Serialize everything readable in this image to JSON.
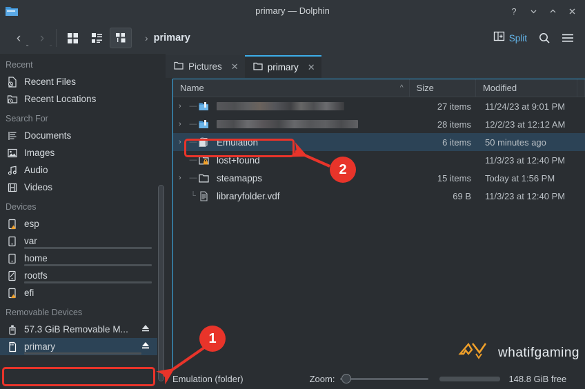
{
  "window": {
    "title": "primary — Dolphin",
    "icon": "folder-icon",
    "buttons": [
      {
        "name": "help-button",
        "glyph": "?"
      },
      {
        "name": "minimize-button",
        "glyph": "chevron-down-icon"
      },
      {
        "name": "maximize-button",
        "glyph": "chevron-up-icon"
      },
      {
        "name": "close-button",
        "glyph": "close-icon"
      }
    ]
  },
  "toolbar": {
    "back_label": "back-icon",
    "forward_label": "forward-icon",
    "view_icons": [
      "icons-view-icon",
      "compact-view-icon",
      "details-view-icon"
    ],
    "active_view_index": 2,
    "breadcrumb_separator": "›",
    "breadcrumb": "primary",
    "split_label": "Split",
    "search_label": "search-icon",
    "menu_label": "hamburger-menu-icon"
  },
  "sidebar": {
    "sections": [
      {
        "title": "Recent",
        "items": [
          {
            "label": "Recent Files",
            "icon": "recent-file-icon"
          },
          {
            "label": "Recent Locations",
            "icon": "recent-folder-icon"
          }
        ]
      },
      {
        "title": "Search For",
        "items": [
          {
            "label": "Documents",
            "icon": "document-icon"
          },
          {
            "label": "Images",
            "icon": "image-icon"
          },
          {
            "label": "Audio",
            "icon": "audio-icon"
          },
          {
            "label": "Videos",
            "icon": "video-icon"
          }
        ]
      },
      {
        "title": "Devices",
        "items": [
          {
            "label": "esp",
            "icon": "drive-warning-icon",
            "capacity": null
          },
          {
            "label": "var",
            "icon": "drive-icon",
            "capacity": 11
          },
          {
            "label": "home",
            "icon": "drive-icon",
            "capacity": 53
          },
          {
            "label": "rootfs",
            "icon": "drive-linux-icon",
            "capacity": 60
          },
          {
            "label": "efi",
            "icon": "drive-warning-icon",
            "capacity": null
          }
        ]
      },
      {
        "title": "Removable Devices",
        "items": [
          {
            "label": "57.3 GiB Removable M...",
            "icon": "usb-drive-icon",
            "capacity": null,
            "eject": true
          },
          {
            "label": "primary",
            "icon": "sd-card-icon",
            "capacity": 36,
            "eject": true,
            "selected": true
          }
        ]
      }
    ]
  },
  "tabs": [
    {
      "label": "Pictures",
      "icon": "folder-icon",
      "close": "✕",
      "active": false
    },
    {
      "label": "primary",
      "icon": "folder-icon",
      "close": "✕",
      "active": true
    }
  ],
  "filelist": {
    "columns": [
      {
        "label": "Name",
        "sort": "^"
      },
      {
        "label": "Size"
      },
      {
        "label": "Modified"
      }
    ],
    "rows": [
      {
        "name": "",
        "blurred": true,
        "icon": "blue-folder-icon",
        "expandable": true,
        "size": "27 items",
        "modified": "11/24/23 at 9:01 PM",
        "selected": false
      },
      {
        "name": "",
        "blurred": true,
        "icon": "blue-folder-icon",
        "expandable": true,
        "size": "28 items",
        "modified": "12/2/23 at 12:12 AM",
        "selected": false
      },
      {
        "name": "Emulation",
        "blurred": false,
        "icon": "folder-link-icon",
        "expandable": true,
        "size": "6 items",
        "modified": "50 minutes ago",
        "selected": true
      },
      {
        "name": "lost+found",
        "blurred": false,
        "icon": "folder-locked-icon",
        "expandable": false,
        "size": "",
        "modified": "11/3/23 at 12:40 PM",
        "selected": false
      },
      {
        "name": "steamapps",
        "blurred": false,
        "icon": "folder-icon",
        "expandable": true,
        "size": "15 items",
        "modified": "Today at 1:56 PM",
        "selected": false
      },
      {
        "name": "libraryfolder.vdf",
        "blurred": false,
        "icon": "text-file-icon",
        "expandable": false,
        "size": "69 B",
        "modified": "11/3/23 at 12:40 PM",
        "selected": false
      }
    ]
  },
  "statusbar": {
    "selection_info": "Emulation (folder)",
    "zoom_label": "Zoom:",
    "zoom_value": 2,
    "free_percent": 42,
    "free_text": "148.8 GiB free"
  },
  "watermark": {
    "text": "whatifgaming",
    "logo_color": "#f0a02a"
  },
  "annotations": {
    "marker1": "1",
    "marker2": "2",
    "color": "#e8342a"
  }
}
